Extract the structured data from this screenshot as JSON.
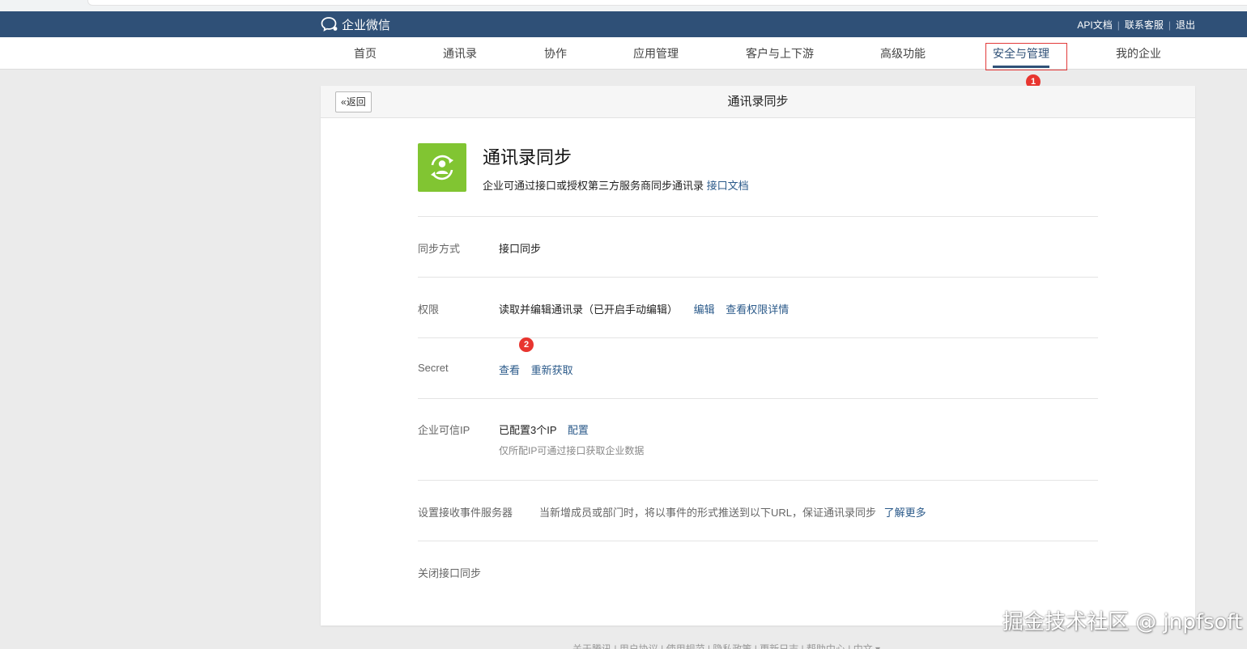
{
  "brand": {
    "name": "企业微信"
  },
  "top_links": [
    "API文档",
    "联系客服",
    "退出"
  ],
  "nav": {
    "items": [
      "首页",
      "通讯录",
      "协作",
      "应用管理",
      "客户与上下游",
      "高级功能",
      "安全与管理",
      "我的企业"
    ],
    "active": "安全与管理"
  },
  "markers": [
    "1",
    "2"
  ],
  "page": {
    "back_label": "返回",
    "title": "通讯录同步"
  },
  "app": {
    "name": "通讯录同步",
    "description": "企业可通过接口或授权第三方服务商同步通讯录",
    "doc_link": "接口文档"
  },
  "rows": {
    "sync_method": {
      "label": "同步方式",
      "value": "接口同步"
    },
    "permission": {
      "label": "权限",
      "value": "读取并编辑通讯录（已开启手动编辑）",
      "edit": "编辑",
      "details": "查看权限详情"
    },
    "secret": {
      "label": "Secret",
      "view": "查看",
      "refresh": "重新获取"
    },
    "trusted_ip": {
      "label": "企业可信IP",
      "value": "已配置3个IP",
      "config": "配置",
      "hint": "仅所配IP可通过接口获取企业数据"
    },
    "event_server": {
      "label": "设置接收事件服务器",
      "desc": "当新增成员或部门时，将以事件的形式推送到以下URL，保证通讯录同步",
      "more": "了解更多"
    },
    "close": {
      "label": "关闭接口同步"
    }
  },
  "footer": {
    "text": "关于腾讯 | 用户协议 | 使用规范 | 隐私政策 | 更新日志 | 帮助中心 | 中文 ▾"
  },
  "watermark": "掘金技术社区 @ jnpfsoft",
  "colors": {
    "topbar": "#2f5077",
    "app_icon": "#81c532",
    "link": "#2b5a8a",
    "marker": "#e8352f"
  }
}
